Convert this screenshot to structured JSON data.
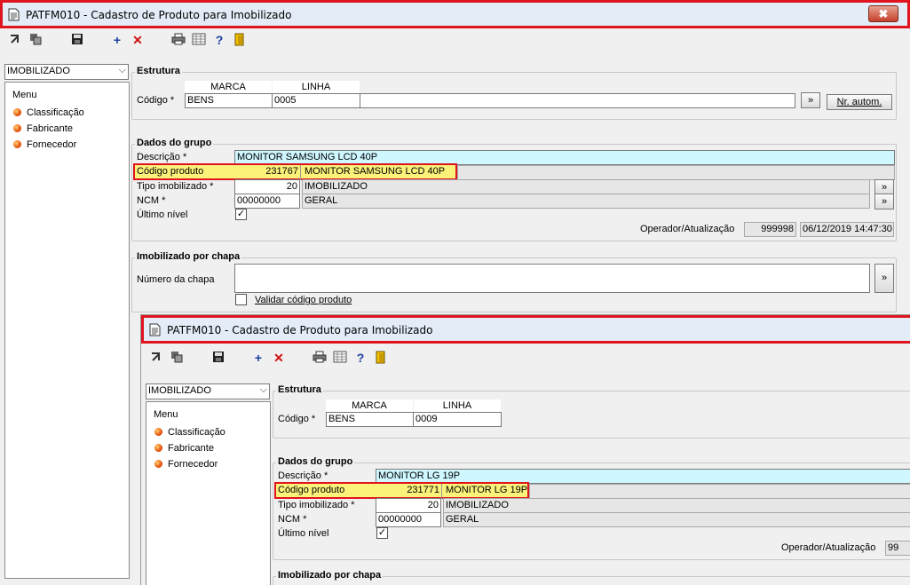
{
  "window": {
    "title": "PATFM010 - Cadastro de Produto para Imobilizado",
    "close_label": "✖"
  },
  "left": {
    "combo_value": "IMOBILIZADO",
    "menu_title": "Menu",
    "items": [
      "Classificação",
      "Fabricante",
      "Fornecedor"
    ]
  },
  "estrutura": {
    "title": "Estrutura",
    "col_marca": "MARCA",
    "col_linha": "LINHA",
    "codigo_label": "Código *",
    "nr_autom_label": "Nr. autom."
  },
  "dados": {
    "title": "Dados do grupo",
    "descricao_label": "Descrição *",
    "codigo_produto_label": "Código produto",
    "tipo_label": "Tipo imobilizado *",
    "ncm_label": "NCM *",
    "ultimo_label": "Último nível",
    "operador_label": "Operador/Atualização"
  },
  "chapa": {
    "title": "Imobilizado por chapa",
    "numero_label": "Número da chapa",
    "validar_label": "Validar código produto"
  },
  "record1": {
    "marca": "BENS",
    "linha": "0005",
    "descricao": "MONITOR SAMSUNG LCD 40P",
    "codigo_produto": "231767",
    "codigo_produto_desc": "MONITOR SAMSUNG LCD 40P",
    "tipo_code": "20",
    "tipo_desc": "IMOBILIZADO",
    "ncm_code": "00000000",
    "ncm_desc": "GERAL",
    "operador": "999998",
    "atualizacao": "06/12/2019 14:47:30"
  },
  "record2": {
    "marca": "BENS",
    "linha": "0009",
    "descricao": "MONITOR LG 19P",
    "codigo_produto": "231771",
    "codigo_produto_desc": "MONITOR LG 19P",
    "tipo_code": "20",
    "tipo_desc": "IMOBILIZADO",
    "ncm_code": "00000000",
    "ncm_desc": "GERAL",
    "operador": "99"
  },
  "colors": {
    "highlight_border": "#e0141e",
    "highlight_fill": "#fbf27a",
    "description_fill": "#cff7ff"
  }
}
